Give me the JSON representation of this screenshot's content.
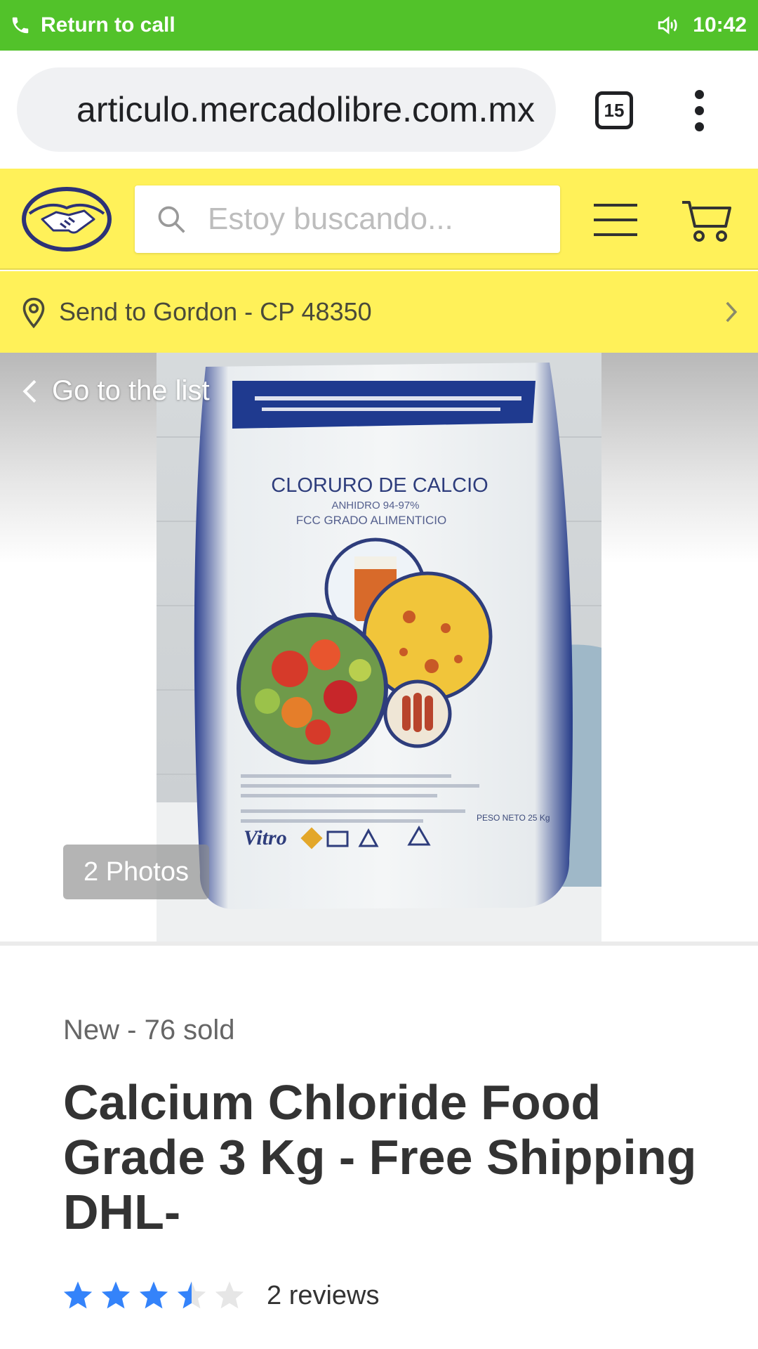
{
  "status_bar": {
    "call_label": "Return to call",
    "time": "10:42",
    "color": "#52c22a"
  },
  "browser": {
    "url": "articulo.mercadolibre.com.mx",
    "tab_count": "15"
  },
  "header": {
    "brand_color": "#fff159",
    "search_placeholder": "Estoy buscando..."
  },
  "location": {
    "text": "Send to Gordon - CP 48350"
  },
  "gallery": {
    "back_label": "Go to the list",
    "photos_badge": "2 Photos",
    "product_image": {
      "bag_title": "CLORURO DE CALCIO",
      "bag_subtitle_1": "ANHIDRO 94-97%",
      "bag_subtitle_2": "FCC GRADO ALIMENTICIO",
      "brand": "Vitro",
      "net_weight": "PESO NETO 25 Kg"
    }
  },
  "product": {
    "condition": "New - 76 sold",
    "title": "Calcium Chloride Food Grade 3 Kg - Free Shipping DHL-",
    "rating": 3.5,
    "rating_max": 5,
    "star_color": "#3483fa",
    "reviews": "2 reviews"
  }
}
